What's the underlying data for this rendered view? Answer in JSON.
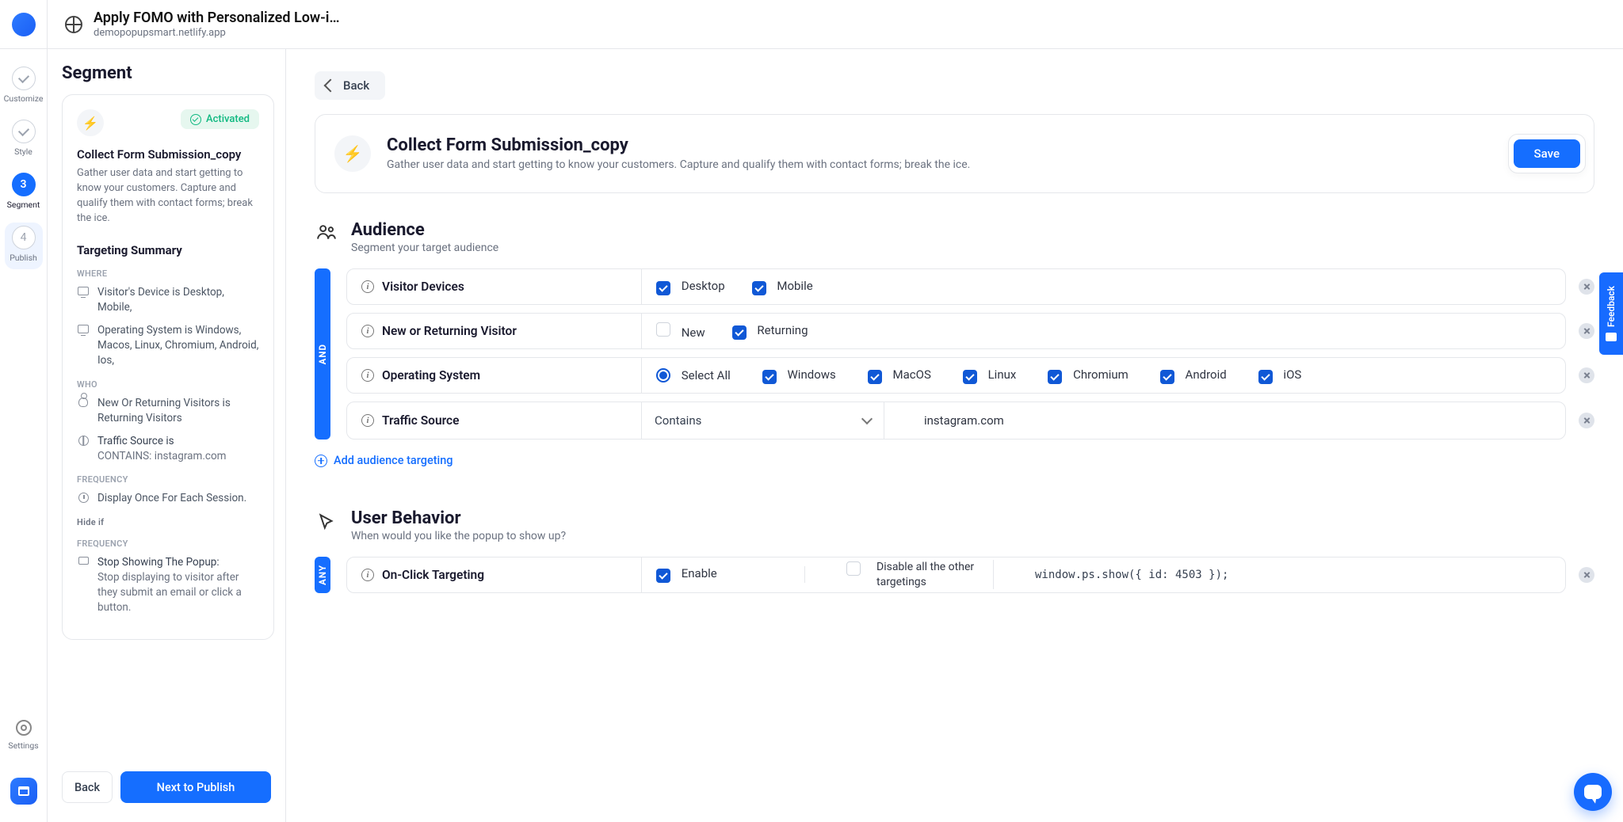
{
  "header": {
    "title": "Apply FOMO with Personalized Low-i…",
    "subtitle": "demopopupsmart.netlify.app"
  },
  "rail": {
    "steps": [
      {
        "id": "customize",
        "label": "Customize",
        "num": "",
        "check": true
      },
      {
        "id": "style",
        "label": "Style",
        "num": "",
        "check": true
      },
      {
        "id": "segment",
        "label": "Segment",
        "num": "3",
        "active": true
      },
      {
        "id": "publish",
        "label": "Publish",
        "num": "4",
        "highlight": true
      }
    ],
    "settings_label": "Settings"
  },
  "left": {
    "title": "Segment",
    "card": {
      "badge": "Activated",
      "name": "Collect Form Submission_copy",
      "desc": "Gather user data and start getting to know your customers. Capture and qualify them with contact forms; break the ice.",
      "summary_title": "Targeting Summary",
      "groups": {
        "where": {
          "label": "WHERE",
          "rows": [
            {
              "icon": "monitor",
              "text": "Visitor's Device is Desktop, Mobile,"
            },
            {
              "icon": "monitor",
              "text": "Operating System is Windows, Macos, Linux, Chromium, Android, Ios,"
            }
          ]
        },
        "who": {
          "label": "WHO",
          "rows": [
            {
              "icon": "person",
              "text": "New Or Returning Visitors is Returning Visitors"
            },
            {
              "icon": "globe",
              "text": "Traffic Source is",
              "sub": "CONTAINS: instagram.com"
            }
          ]
        },
        "freq1": {
          "label": "FREQUENCY",
          "rows": [
            {
              "icon": "clock",
              "text": "Display Once For Each Session."
            }
          ]
        },
        "hide": {
          "label": "Hide if"
        },
        "freq2": {
          "label": "FREQUENCY",
          "rows": [
            {
              "icon": "stop",
              "text": "Stop Showing The Popup:",
              "sub": "Stop displaying to visitor after they submit an email or click a button."
            }
          ]
        }
      }
    },
    "actions": {
      "back": "Back",
      "next": "Next to Publish"
    }
  },
  "main": {
    "back": "Back",
    "hero": {
      "title": "Collect Form Submission_copy",
      "desc": "Gather user data and start getting to know your customers. Capture and qualify them with contact forms; break the ice.",
      "save": "Save"
    },
    "audience": {
      "title": "Audience",
      "sub": "Segment your target audience",
      "connector": "AND",
      "rules": {
        "devices": {
          "label": "Visitor Devices",
          "opts": [
            {
              "label": "Desktop",
              "on": true
            },
            {
              "label": "Mobile",
              "on": true
            }
          ]
        },
        "newret": {
          "label": "New or Returning Visitor",
          "opts": [
            {
              "label": "New",
              "on": false
            },
            {
              "label": "Returning",
              "on": true
            }
          ]
        },
        "os": {
          "label": "Operating System",
          "all": {
            "label": "Select All",
            "on": true
          },
          "opts": [
            {
              "label": "Windows",
              "on": true
            },
            {
              "label": "MacOS",
              "on": true
            },
            {
              "label": "Linux",
              "on": true
            },
            {
              "label": "Chromium",
              "on": true
            },
            {
              "label": "Android",
              "on": true
            },
            {
              "label": "iOS",
              "on": true
            }
          ]
        },
        "traffic": {
          "label": "Traffic Source",
          "operator": "Contains",
          "value": "instagram.com"
        }
      },
      "add": "Add audience targeting"
    },
    "behavior": {
      "title": "User Behavior",
      "sub": "When would you like the popup to show up?",
      "connector": "ANY",
      "onclick": {
        "label": "On-Click Targeting",
        "enable": {
          "label": "Enable",
          "on": true
        },
        "disable": {
          "on": false,
          "label": "Disable all the other targetings"
        },
        "code": "window.ps.show({ id: 4503 });"
      }
    }
  },
  "feedback_label": "Feedback"
}
